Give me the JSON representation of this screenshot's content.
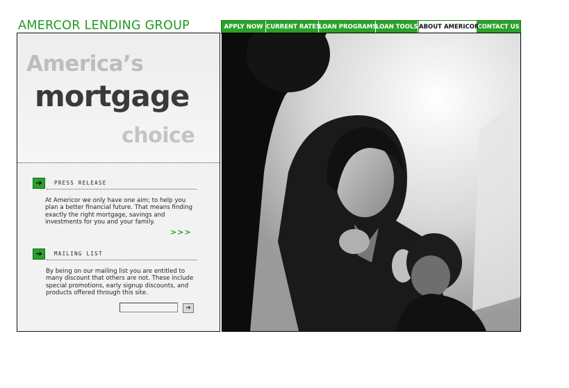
{
  "brand": {
    "logo_text": "AMERCOR LENDING GROUP"
  },
  "nav": {
    "items": [
      {
        "label": "APPLY NOW"
      },
      {
        "label": "CURRENT RATES"
      },
      {
        "label": "LOAN PROGRAMS"
      },
      {
        "label": "LOAN TOOLS"
      },
      {
        "label": "ABOUT AMERICOR",
        "active": true
      },
      {
        "label": "CONTACT US"
      }
    ]
  },
  "hero": {
    "line1": "America’s",
    "line2": "mortgage",
    "line3": "choice"
  },
  "press_release": {
    "title": "PRESS RELEASE",
    "body": "At Americor we only have one aim; to help you plan a better financial future. That means finding exactly the right mortgage, savings and investments for you and your family.",
    "more_link": ">>>"
  },
  "mailing_list": {
    "title": "MAILING LIST",
    "body": "By being on our mailing list you are entitled to many discount that others are not. These include special promotions, early signup discounts, and products offered through this site.",
    "input_value": "",
    "submit_icon": "arrow-right-icon"
  },
  "colors": {
    "brand_green": "#2aa12a",
    "text_dark": "#3a3a3a",
    "text_light": "#bdbdbd"
  }
}
